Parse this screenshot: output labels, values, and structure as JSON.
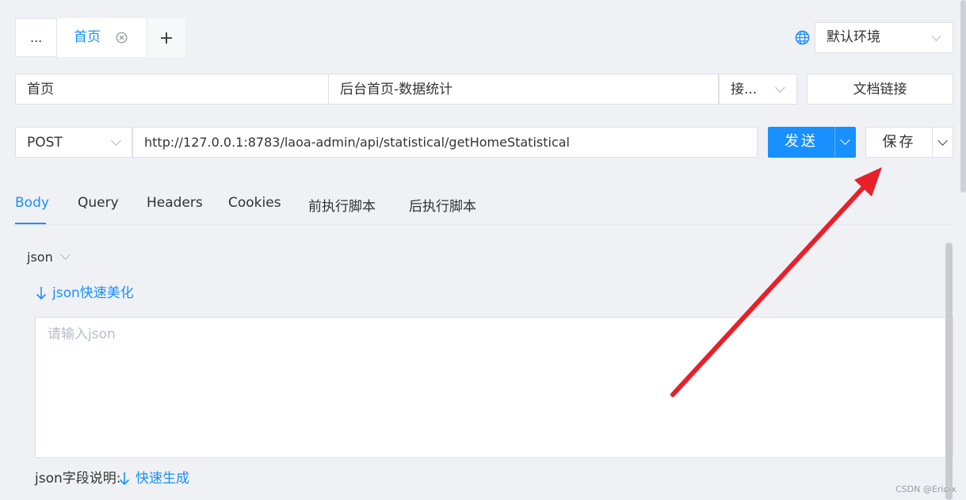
{
  "tabs": {
    "more_label": "...",
    "active_label": "首页",
    "add_label": "+"
  },
  "env": {
    "selected": "默认环境"
  },
  "info": {
    "folder": "首页",
    "name": "后台首页-数据统计",
    "type_short": "接...",
    "doc_link_label": "文档链接"
  },
  "request": {
    "method": "POST",
    "url": "http://127.0.0.1:8783/laoa-admin/api/statistical/getHomeStatistical",
    "send_label": "发送",
    "save_label": "保存"
  },
  "subtabs": [
    "Body",
    "Query",
    "Headers",
    "Cookies",
    "前执行脚本",
    "后执行脚本"
  ],
  "body": {
    "format": "json",
    "beautify_label": "json快速美化",
    "placeholder": "请输入json",
    "fields_label": "json字段说明:",
    "generate_label": "快速生成"
  },
  "watermark": "CSDN @Eric-x",
  "colors": {
    "accent": "#1890ff",
    "background": "#f0f1f5",
    "arrow": "#e8202a"
  },
  "icons": [
    "close-circle-icon",
    "plus-icon",
    "globe-icon",
    "chevron-down-icon",
    "arrow-down-icon"
  ]
}
